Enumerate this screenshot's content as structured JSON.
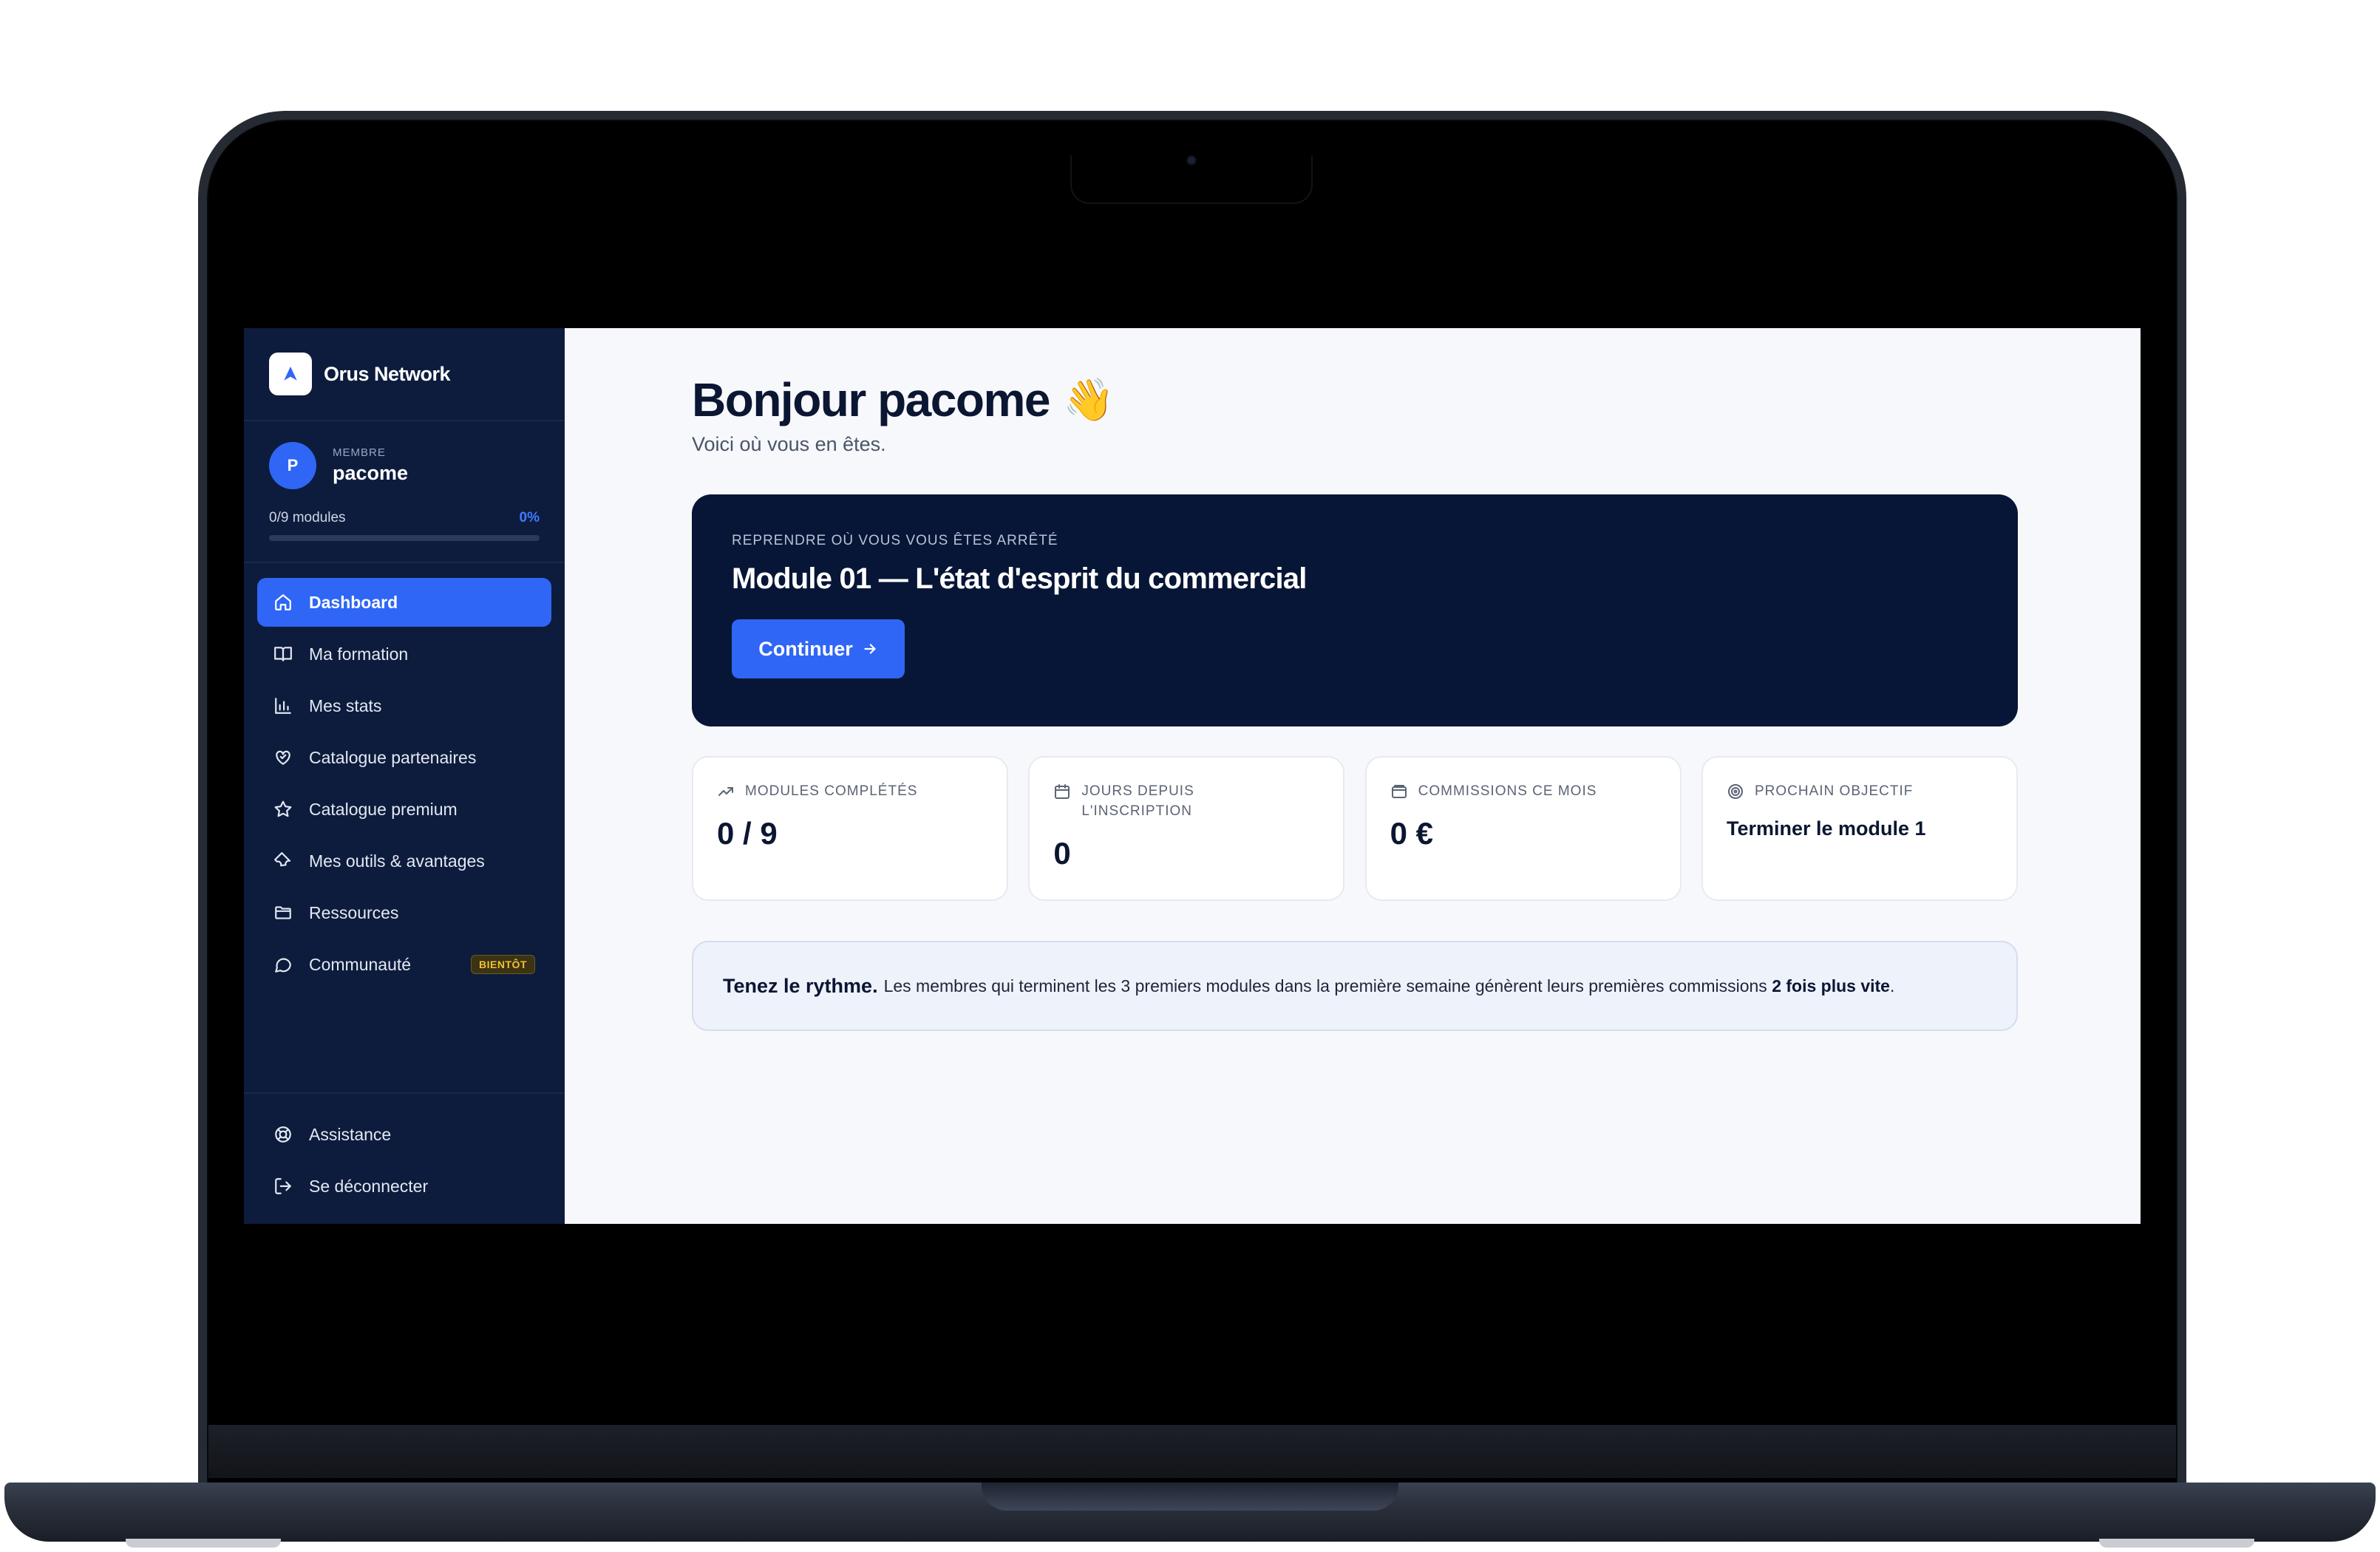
{
  "brand": {
    "name": "Orus Network"
  },
  "member": {
    "initial": "P",
    "role": "MEMBRE",
    "name": "pacome",
    "progress_label": "0/9 modules",
    "progress_pct": "0%",
    "progress_value": 0
  },
  "nav": {
    "items": [
      {
        "label": "Dashboard",
        "icon": "home-icon",
        "active": true
      },
      {
        "label": "Ma formation",
        "icon": "book-icon"
      },
      {
        "label": "Mes stats",
        "icon": "bar-chart-icon"
      },
      {
        "label": "Catalogue partenaires",
        "icon": "handshake-icon"
      },
      {
        "label": "Catalogue premium",
        "icon": "star-icon"
      },
      {
        "label": "Mes outils & avantages",
        "icon": "wrench-icon"
      },
      {
        "label": "Ressources",
        "icon": "folder-icon"
      },
      {
        "label": "Communauté",
        "icon": "chat-icon",
        "badge": "BIENTÔT"
      }
    ],
    "footer": [
      {
        "label": "Assistance",
        "icon": "lifebuoy-icon"
      },
      {
        "label": "Se déconnecter",
        "icon": "logout-icon"
      }
    ]
  },
  "main": {
    "greeting": "Bonjour pacome",
    "wave_emoji": "👋",
    "subtitle": "Voici où vous en êtes.",
    "resume": {
      "kicker": "REPRENDRE OÙ VOUS VOUS ÊTES ARRÊTÉ",
      "title": "Module 01 — L'état d'esprit du commercial",
      "button": "Continuer"
    },
    "stats": [
      {
        "label": "MODULES COMPLÉTÉS",
        "value": "0 / 9",
        "icon": "trend-up-icon"
      },
      {
        "label": "JOURS DEPUIS L'INSCRIPTION",
        "value": "0",
        "icon": "calendar-icon"
      },
      {
        "label": "COMMISSIONS CE MOIS",
        "value": "0 €",
        "icon": "wallet-icon"
      },
      {
        "label": "PROCHAIN OBJECTIF",
        "value": "Terminer le module 1",
        "icon": "target-icon"
      }
    ],
    "tip": {
      "lead": "Tenez le rythme.",
      "text": "Les membres qui terminent les 3 premiers modules dans la première semaine génèrent leurs premières commissions",
      "emphasis": "2 fois plus vite",
      "end": "."
    }
  },
  "colors": {
    "sidebar": "#0d1c3d",
    "accent": "#2f66f5",
    "card_dark": "#071636",
    "badge": "#f1c232"
  }
}
